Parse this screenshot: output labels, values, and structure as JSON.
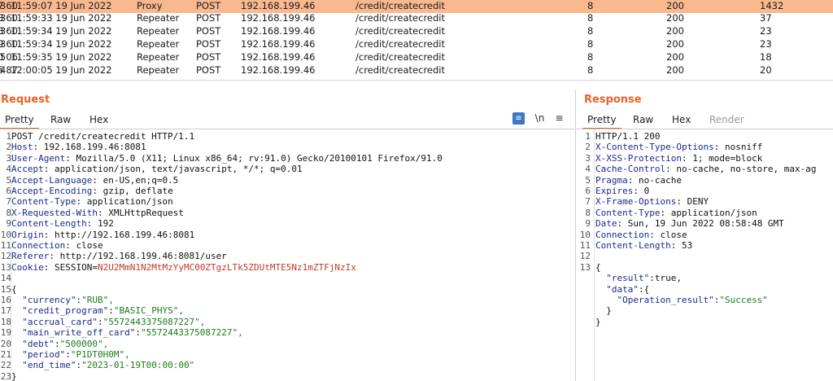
{
  "history": {
    "rows": [
      {
        "num": "7",
        "time": "11:59:07 19 Jun 2022",
        "tool": "Proxy",
        "method": "POST",
        "host": "192.168.199.46",
        "url": "/credit/createcredit",
        "params": "8",
        "status": "200",
        "length": "360",
        "rtt": "1432",
        "selected": true
      },
      {
        "num": "8",
        "time": "11:59:33 19 Jun 2022",
        "tool": "Repeater",
        "method": "POST",
        "host": "192.168.199.46",
        "url": "/credit/createcredit",
        "params": "8",
        "status": "200",
        "length": "360",
        "rtt": "37",
        "selected": false
      },
      {
        "num": "8",
        "time": "11:59:34 19 Jun 2022",
        "tool": "Repeater",
        "method": "POST",
        "host": "192.168.199.46",
        "url": "/credit/createcredit",
        "params": "8",
        "status": "200",
        "length": "360",
        "rtt": "23",
        "selected": false
      },
      {
        "num": "9",
        "time": "11:59:34 19 Jun 2022",
        "tool": "Repeater",
        "method": "POST",
        "host": "192.168.199.46",
        "url": "/credit/createcredit",
        "params": "8",
        "status": "200",
        "length": "360",
        "rtt": "23",
        "selected": false
      },
      {
        "num": "0",
        "time": "11:59:35 19 Jun 2022",
        "tool": "Repeater",
        "method": "POST",
        "host": "192.168.199.46",
        "url": "/credit/createcredit",
        "params": "8",
        "status": "200",
        "length": "506",
        "rtt": "18",
        "selected": false
      },
      {
        "num": "5",
        "time": "12:00:05 19 Jun 2022",
        "tool": "Repeater",
        "method": "POST",
        "host": "192.168.199.46",
        "url": "/credit/createcredit",
        "params": "8",
        "status": "200",
        "length": "487",
        "rtt": "20",
        "selected": false
      }
    ]
  },
  "request": {
    "title": "Request",
    "tabs": [
      "Pretty",
      "Raw",
      "Hex"
    ],
    "active_tab": "Pretty",
    "tool_icons": [
      "wrap-lines-icon",
      "newline-icon",
      "menu-icon"
    ],
    "newline_label": "\\n",
    "menu_label": "≡",
    "lines": [
      {
        "n": "1",
        "key": "POST /credit/createcredit HTTP/1.1",
        "sep": "",
        "val": "",
        "type": "plain"
      },
      {
        "n": "2",
        "key": "Host",
        "sep": ": ",
        "val": "192.168.199.46:8081",
        "type": "header"
      },
      {
        "n": "3",
        "key": "User-Agent",
        "sep": ": ",
        "val": "Mozilla/5.0 (X11; Linux x86_64; rv:91.0) Gecko/20100101 Firefox/91.0",
        "type": "header"
      },
      {
        "n": "4",
        "key": "Accept",
        "sep": ": ",
        "val": "application/json, text/javascript, */*; q=0.01",
        "type": "header"
      },
      {
        "n": "5",
        "key": "Accept-Language",
        "sep": ": ",
        "val": "en-US,en;q=0.5",
        "type": "header"
      },
      {
        "n": "6",
        "key": "Accept-Encoding",
        "sep": ": ",
        "val": "gzip, deflate",
        "type": "header"
      },
      {
        "n": "7",
        "key": "Content-Type",
        "sep": ": ",
        "val": "application/json",
        "type": "header"
      },
      {
        "n": "8",
        "key": "X-Requested-With",
        "sep": ": ",
        "val": "XMLHttpRequest",
        "type": "header"
      },
      {
        "n": "9",
        "key": "Content-Length",
        "sep": ": ",
        "val": "192",
        "type": "header"
      },
      {
        "n": "10",
        "key": "Origin",
        "sep": ": ",
        "val": "http://192.168.199.46:8081",
        "type": "header"
      },
      {
        "n": "11",
        "key": "Connection",
        "sep": ": ",
        "val": "close",
        "type": "header"
      },
      {
        "n": "12",
        "key": "Referer",
        "sep": ": ",
        "val": "http://192.168.199.46:8081/user",
        "type": "header"
      },
      {
        "n": "13",
        "key": "Cookie",
        "sep": ": SESSION=",
        "val": "N2U2MmN1N2MtMzYyMC00ZTgzLTk5ZDUtMTE5Nz1mZTFjNzIx",
        "type": "cookie"
      },
      {
        "n": "14",
        "key": "",
        "sep": "",
        "val": "",
        "type": "plain"
      },
      {
        "n": "15",
        "key": "{",
        "sep": "",
        "val": "",
        "type": "plain"
      },
      {
        "n": "16",
        "key": "  \"currency\"",
        "sep": ":",
        "val": "\"RUB\",",
        "type": "json"
      },
      {
        "n": "17",
        "key": "  \"credit_program\"",
        "sep": ":",
        "val": "\"BASIC_PHYS\",",
        "type": "json"
      },
      {
        "n": "18",
        "key": "  \"accrual_card\"",
        "sep": ":",
        "val": "\"5572443375087227\",",
        "type": "json"
      },
      {
        "n": "19",
        "key": "  \"main_write_off_card\"",
        "sep": ":",
        "val": "\"5572443375087227\",",
        "type": "json"
      },
      {
        "n": "20",
        "key": "  \"debt\"",
        "sep": ":",
        "val": "\"500000\",",
        "type": "json"
      },
      {
        "n": "21",
        "key": "  \"period\"",
        "sep": ":",
        "val": "\"P1DT0H0M\",",
        "type": "json"
      },
      {
        "n": "22",
        "key": "  \"end_time\"",
        "sep": ":",
        "val": "\"2023-01-19T00:00:00\"",
        "type": "json"
      },
      {
        "n": "23",
        "key": "}",
        "sep": "",
        "val": "",
        "type": "plain"
      }
    ]
  },
  "response": {
    "title": "Response",
    "tabs": [
      "Pretty",
      "Raw",
      "Hex",
      "Render"
    ],
    "active_tab": "Pretty",
    "lines": [
      {
        "n": "1",
        "key": "HTTP/1.1 200",
        "sep": "",
        "val": "",
        "type": "plain"
      },
      {
        "n": "2",
        "key": "X-Content-Type-Options",
        "sep": ": ",
        "val": "nosniff",
        "type": "header"
      },
      {
        "n": "3",
        "key": "X-XSS-Protection",
        "sep": ": ",
        "val": "1; mode=block",
        "type": "header"
      },
      {
        "n": "4",
        "key": "Cache-Control",
        "sep": ": ",
        "val": "no-cache, no-store, max-ag",
        "type": "header"
      },
      {
        "n": "5",
        "key": "Pragma",
        "sep": ": ",
        "val": "no-cache",
        "type": "header"
      },
      {
        "n": "6",
        "key": "Expires",
        "sep": ": ",
        "val": "0",
        "type": "header"
      },
      {
        "n": "7",
        "key": "X-Frame-Options",
        "sep": ": ",
        "val": "DENY",
        "type": "header"
      },
      {
        "n": "8",
        "key": "Content-Type",
        "sep": ": ",
        "val": "application/json",
        "type": "header"
      },
      {
        "n": "9",
        "key": "Date",
        "sep": ": ",
        "val": "Sun, 19 Jun 2022 08:58:48 GMT",
        "type": "header"
      },
      {
        "n": "10",
        "key": "Connection",
        "sep": ": ",
        "val": "close",
        "type": "header"
      },
      {
        "n": "11",
        "key": "Content-Length",
        "sep": ": ",
        "val": "53",
        "type": "header"
      },
      {
        "n": "12",
        "key": "",
        "sep": "",
        "val": "",
        "type": "plain"
      },
      {
        "n": "13",
        "key": "{",
        "sep": "",
        "val": "",
        "type": "plain"
      },
      {
        "n": "",
        "key": "  \"result\"",
        "sep": ":",
        "val": "true,",
        "type": "jsonbool"
      },
      {
        "n": "",
        "key": "  \"data\"",
        "sep": ":",
        "val": "{",
        "type": "jsonbool"
      },
      {
        "n": "",
        "key": "    \"Operation_result\"",
        "sep": ":",
        "val": "\"Success\"",
        "type": "json"
      },
      {
        "n": "",
        "key": "  }",
        "sep": "",
        "val": "",
        "type": "plain"
      },
      {
        "n": "",
        "key": "}",
        "sep": "",
        "val": "",
        "type": "plain"
      }
    ]
  }
}
